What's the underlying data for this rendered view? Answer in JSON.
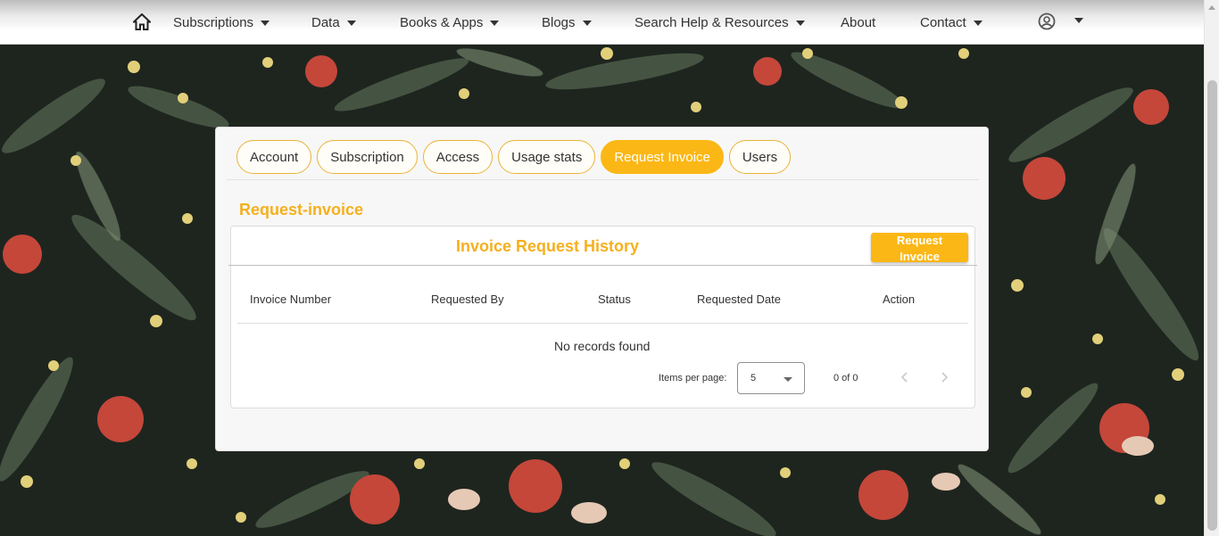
{
  "nav": {
    "items": [
      {
        "label": "Subscriptions",
        "dropdown": true
      },
      {
        "label": "Data",
        "dropdown": true
      },
      {
        "label": "Books & Apps",
        "dropdown": true
      },
      {
        "label": "Blogs",
        "dropdown": true
      },
      {
        "label": "Search Help & Resources",
        "dropdown": true
      },
      {
        "label": "About",
        "dropdown": false
      },
      {
        "label": "Contact",
        "dropdown": true
      }
    ],
    "home_icon": "home-icon",
    "user_icon": "user-circle-icon"
  },
  "tabs": [
    {
      "label": "Account",
      "active": false
    },
    {
      "label": "Subscription",
      "active": false
    },
    {
      "label": "Access",
      "active": false
    },
    {
      "label": "Usage stats",
      "active": false
    },
    {
      "label": "Request Invoice",
      "active": true
    },
    {
      "label": "Users",
      "active": false
    }
  ],
  "section_title": "Request-invoice",
  "history": {
    "title": "Invoice Request History",
    "request_button_line1": "Request",
    "request_button_line2": "Invoice",
    "columns": [
      "Invoice Number",
      "Requested By",
      "Status",
      "Requested Date",
      "Action"
    ],
    "empty_text": "No records found"
  },
  "paginator": {
    "items_per_page_label": "Items per page:",
    "page_size": "5",
    "range_label": "0 of 0"
  },
  "colors": {
    "accent": "#fbb715",
    "title": "#f5b01e"
  }
}
